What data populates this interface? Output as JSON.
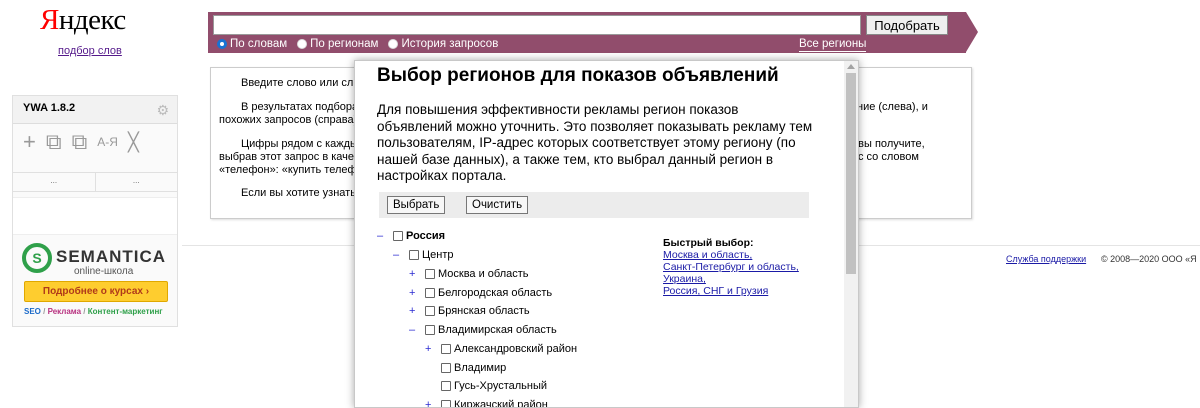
{
  "header": {
    "logo_y": "Я",
    "logo_rest": "ндекс",
    "sublink": "подбор слов"
  },
  "search": {
    "value": "",
    "placeholder": "",
    "button": "Подобрать",
    "modes": [
      {
        "label": "По словам",
        "selected": true
      },
      {
        "label": "По регионам",
        "selected": false
      },
      {
        "label": "История запросов",
        "selected": false
      }
    ],
    "all_regions": "Все регионы"
  },
  "main": {
    "p1": "Введите слово или слов",
    "p2a": "В результатах подбора",
    "p2b": "похожих запросов (справа).",
    "p2r": "ние (слева), и",
    "p3a": "Цифры рядом с кажды",
    "p3b": "выбрав этот запрос в качест",
    "p3c": "«телефон»: «купить телефо",
    "p3r1": "е вы получите,",
    "p3r2": "с со словом",
    "p4": "Если вы хотите узнать"
  },
  "footer": {
    "support": "Служба поддержки",
    "copyright": "© 2008—2020  ООО «Я"
  },
  "ywa": {
    "title": "YWA 1.8.2",
    "tools": {
      "plus": "+",
      "copy": "⧉",
      "az": "А-Я",
      "close": "╳"
    },
    "dots": [
      "...",
      "..."
    ]
  },
  "ad": {
    "title": "SEMANTICA",
    "subtitle": "online-школа",
    "button": "Подробнее о курсах ›",
    "tag1": "SEO",
    "sep": " / ",
    "tag2": "Реклама",
    "tag3": "Контент-маркетинг"
  },
  "modal": {
    "title": "Выбор регионов для показов объявлений",
    "description": "Для повышения эффективности рекламы регион показов объявлений можно уточнить. Это позволяет показывать рекламу тем пользователям, IP-адрес которых соответствует этому региону (по нашей базе данных), а также тем, кто выбрал данный регион в настройках портала.",
    "select_button": "Выбрать",
    "clear_button": "Очистить",
    "tree": [
      {
        "toggle": "–",
        "label": "Россия",
        "bold": true
      },
      {
        "toggle": "–",
        "label": "Центр",
        "bold": false
      },
      {
        "toggle": "+",
        "label": "Москва и область",
        "bold": false
      },
      {
        "toggle": "+",
        "label": "Белгородская область",
        "bold": false
      },
      {
        "toggle": "+",
        "label": "Брянская область",
        "bold": false
      },
      {
        "toggle": "–",
        "label": "Владимирская область",
        "bold": false
      },
      {
        "toggle": "+",
        "label": "Александровский район",
        "bold": false
      },
      {
        "toggle": "",
        "label": "Владимир",
        "bold": false
      },
      {
        "toggle": "",
        "label": "Гусь-Хрустальный",
        "bold": false
      },
      {
        "toggle": "+",
        "label": "Киржачский район",
        "bold": false
      }
    ],
    "quick_title": "Быстрый выбор:",
    "quick_links": [
      "Москва и область,",
      "Санкт-Петербург и область,",
      "Украина,",
      "Россия, СНГ и Грузия"
    ]
  }
}
